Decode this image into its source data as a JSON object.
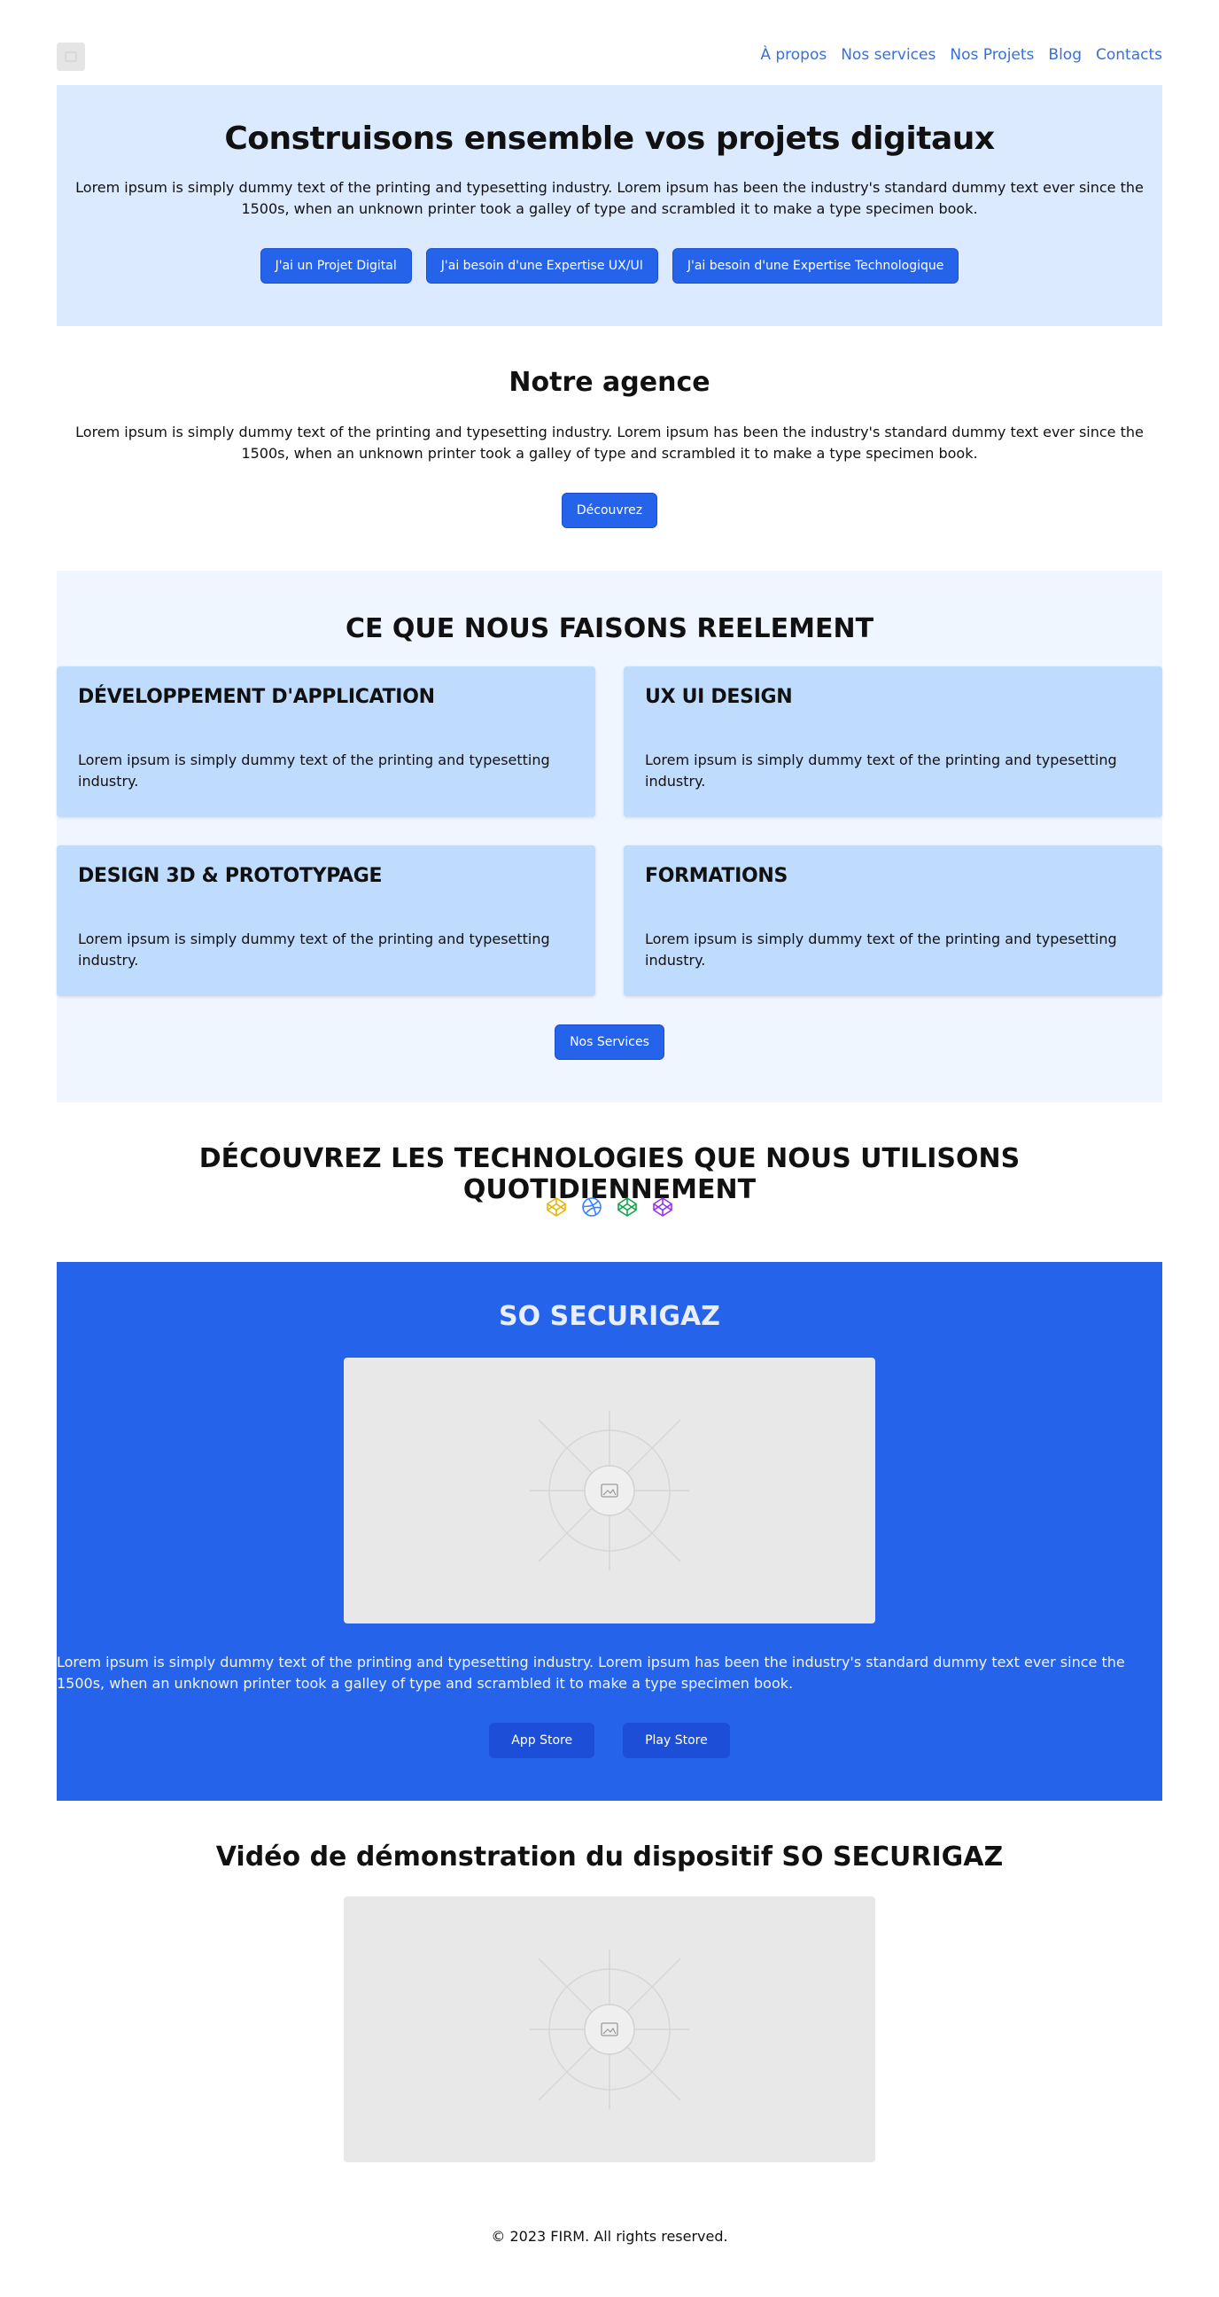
{
  "header": {
    "nav": [
      "À propos",
      "Nos services",
      "Nos Projets",
      "Blog",
      "Contacts"
    ]
  },
  "hero": {
    "title": "Construisons ensemble vos projets digitaux",
    "text": "Lorem ipsum is simply dummy text of the printing and typesetting industry. Lorem ipsum has been the industry's standard dummy text ever since the 1500s, when an unknown printer took a galley of type and scrambled it to make a type specimen book.",
    "buttons": [
      "J'ai un Projet Digital",
      "J'ai besoin d'une Expertise UX/UI",
      "J'ai besoin d'une Expertise Technologique"
    ]
  },
  "agency": {
    "title": "Notre agence",
    "text": "Lorem ipsum is simply dummy text of the printing and typesetting industry. Lorem ipsum has been the industry's standard dummy text ever since the 1500s, when an unknown printer took a galley of type and scrambled it to make a type specimen book.",
    "button": "Découvrez"
  },
  "services": {
    "title": "CE QUE NOUS FAISONS REELEMENT",
    "cards": [
      {
        "title": "DÉVELOPPEMENT D'APPLICATION",
        "text": "Lorem ipsum is simply dummy text of the printing and typesetting industry."
      },
      {
        "title": "UX UI DESIGN",
        "text": "Lorem ipsum is simply dummy text of the printing and typesetting industry."
      },
      {
        "title": "DESIGN 3D & PROTOTYPAGE",
        "text": "Lorem ipsum is simply dummy text of the printing and typesetting industry."
      },
      {
        "title": "FORMATIONS",
        "text": "Lorem ipsum is simply dummy text of the printing and typesetting industry."
      }
    ],
    "button": "Nos Services"
  },
  "tech": {
    "title": "DÉCOUVREZ LES TECHNOLOGIES QUE NOUS UTILISONS QUOTIDIENNEMENT",
    "icons": [
      {
        "name": "codepen-icon",
        "color": "#eab308"
      },
      {
        "name": "dribbble-icon",
        "color": "#3b82f6"
      },
      {
        "name": "codepen-icon",
        "color": "#16a34a"
      },
      {
        "name": "codepen-icon",
        "color": "#9333ea"
      }
    ]
  },
  "product": {
    "title": "SO SECURIGAZ",
    "text": "Lorem ipsum is simply dummy text of the printing and typesetting industry. Lorem ipsum has been the industry's standard dummy text ever since the 1500s, when an unknown printer took a galley of type and scrambled it to make a type specimen book.",
    "buttons": [
      "App Store",
      "Play Store"
    ]
  },
  "video": {
    "title": "Vidéo de démonstration du dispositif SO SECURIGAZ"
  },
  "footer": {
    "text": "© 2023 FIRM. All rights reserved."
  },
  "colors": {
    "accent": "#2563eb",
    "hero_bg": "#dbeafe",
    "services_bg": "#eff6ff",
    "card_bg": "#bfdbfe",
    "nav_link": "#3b6fd6"
  }
}
